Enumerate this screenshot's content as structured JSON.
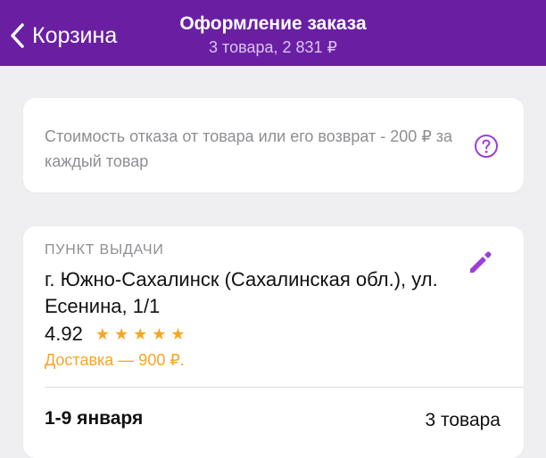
{
  "header": {
    "back_label": "Корзина",
    "title": "Оформление заказа",
    "subtitle": "3 товара, 2 831 ₽",
    "background": "#6a1fa3"
  },
  "info": {
    "text": "Стоимость отказа от товара или его возврат - 200 ₽ за каждый товар",
    "icon": "question-circle-icon"
  },
  "pickup": {
    "caption": "ПУНКТ ВЫДАЧИ",
    "address": "г. Южно-Сахалинск (Сахалинская обл.), ул. Есенина, 1/1",
    "rating": "4.92",
    "stars": 5,
    "delivery": "Доставка — 900 ₽.",
    "edit_icon": "pencil-icon"
  },
  "shipment": {
    "dates": "1-9 января",
    "count": "3 товара"
  },
  "colors": {
    "accent": "#9b3fd6",
    "star": "#f5a623",
    "muted": "#8e8e93"
  }
}
